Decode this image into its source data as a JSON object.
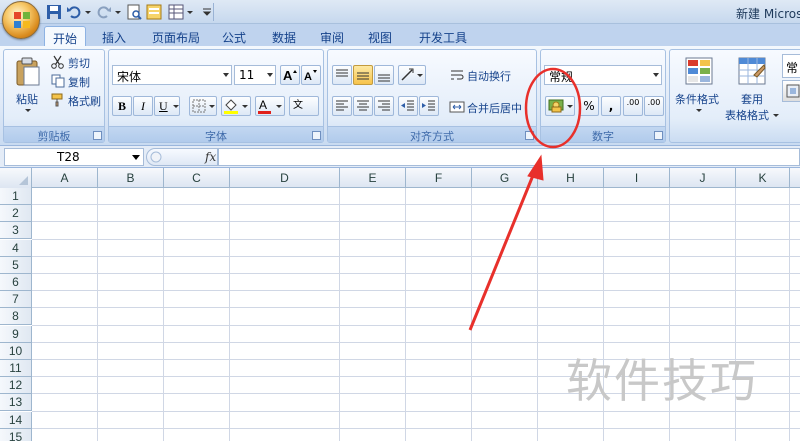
{
  "window": {
    "title": "新建 Micros"
  },
  "tabs": [
    {
      "label": "开始",
      "active": true
    },
    {
      "label": "插入"
    },
    {
      "label": "页面布局"
    },
    {
      "label": "公式"
    },
    {
      "label": "数据"
    },
    {
      "label": "审阅"
    },
    {
      "label": "视图"
    },
    {
      "label": "开发工具"
    }
  ],
  "clipboard": {
    "group_label": "剪贴板",
    "paste": "粘贴",
    "cut": "剪切",
    "copy": "复制",
    "format_painter": "格式刷"
  },
  "font": {
    "group_label": "字体",
    "font_name": "宋体",
    "font_size": "11",
    "bold": "B",
    "italic": "I",
    "underline": "U",
    "font_color_glyph": "A",
    "phonetic_glyph": "文"
  },
  "alignment": {
    "group_label": "对齐方式",
    "wrap_text": "自动换行",
    "merge_center": "合并后居中"
  },
  "number": {
    "group_label": "数字",
    "format": "常规",
    "percent": "%",
    "comma": ",",
    "increase_decimal": ".00",
    "decrease_decimal": ".00"
  },
  "styles": {
    "conditional_format": "条件格式",
    "format_as_table_line1": "套用",
    "format_as_table_line2": "表格格式",
    "cell_style_partial": "常"
  },
  "formula_bar": {
    "name_box": "T28",
    "fx": "fx"
  },
  "columns": [
    "A",
    "B",
    "C",
    "D",
    "E",
    "F",
    "G",
    "H",
    "I",
    "J",
    "K"
  ],
  "rows": [
    "1",
    "2",
    "3",
    "4",
    "5",
    "6",
    "7",
    "8",
    "9",
    "10",
    "11",
    "12",
    "13",
    "14",
    "15"
  ],
  "watermark": "软件技巧",
  "colors": {
    "annotation": "#e8302b",
    "ribbon_text": "#15428b",
    "gridline": "#d0d7e5"
  }
}
